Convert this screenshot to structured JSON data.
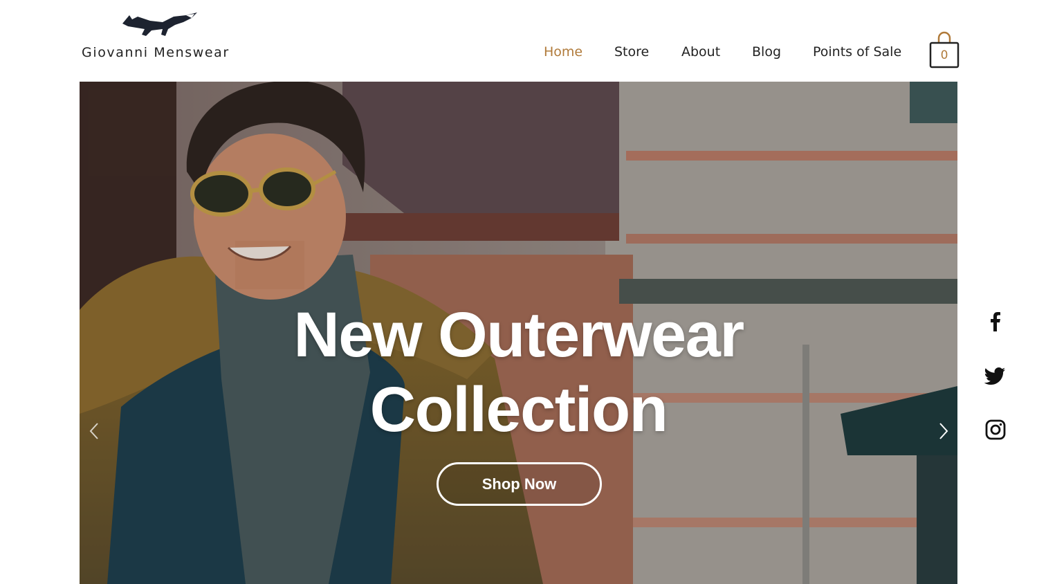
{
  "brand": {
    "name": "Giovanni Menswear",
    "logo_icon": "fox-logo-icon"
  },
  "nav": {
    "items": [
      {
        "label": "Home",
        "active": true
      },
      {
        "label": "Store",
        "active": false
      },
      {
        "label": "About",
        "active": false
      },
      {
        "label": "Blog",
        "active": false
      },
      {
        "label": "Points of Sale",
        "active": false
      }
    ],
    "active_color": "#b07a3a"
  },
  "cart": {
    "icon": "shopping-bag-icon",
    "count": "0"
  },
  "hero": {
    "title_line1": "New Outerwear",
    "title_line2": "Collection",
    "button_label": "Shop Now",
    "prev_icon": "chevron-left-icon",
    "next_icon": "chevron-right-icon"
  },
  "social": [
    {
      "icon": "facebook-icon"
    },
    {
      "icon": "twitter-icon"
    },
    {
      "icon": "instagram-icon"
    }
  ]
}
